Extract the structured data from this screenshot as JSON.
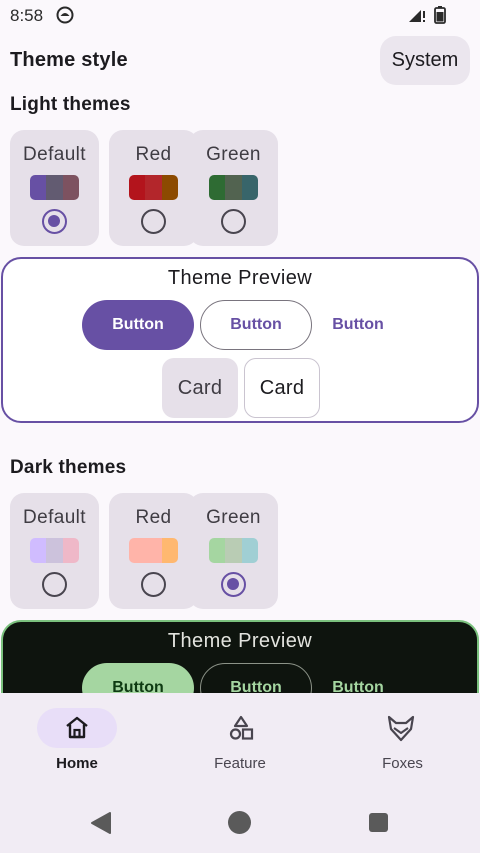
{
  "status_bar": {
    "time": "8:58"
  },
  "header": {
    "title": "Theme style",
    "system_button": "System"
  },
  "light_section": {
    "title": "Light themes",
    "options": [
      {
        "name": "Default",
        "selected": true,
        "swatch": [
          "#6750A4",
          "#625B71",
          "#7D5260"
        ]
      },
      {
        "name": "Red",
        "selected": false,
        "swatch": [
          "#B3141C",
          "#B3262B",
          "#8C4A00"
        ]
      },
      {
        "name": "Green",
        "selected": false,
        "swatch": [
          "#2E6B33",
          "#526350",
          "#38656A"
        ]
      }
    ],
    "preview": {
      "title": "Theme Preview",
      "filled_button": "Button",
      "outlined_button": "Button",
      "text_button": "Button",
      "filled_card": "Card",
      "outlined_card": "Card"
    }
  },
  "dark_section": {
    "title": "Dark themes",
    "options": [
      {
        "name": "Default",
        "selected": false,
        "swatch": [
          "#D0BCFF",
          "#CCC2DC",
          "#EFB8C8"
        ]
      },
      {
        "name": "Red",
        "selected": false,
        "swatch": [
          "#FFB4A9",
          "#FFB4A9",
          "#FFB870"
        ]
      },
      {
        "name": "Green",
        "selected": true,
        "swatch": [
          "#A5D6A1",
          "#B9CCB4",
          "#A0CFD4"
        ]
      }
    ],
    "preview": {
      "title": "Theme Preview",
      "filled_button": "Button",
      "outlined_button": "Button",
      "text_button": "Button"
    }
  },
  "bottom_nav": {
    "items": [
      {
        "label": "Home",
        "icon": "home-icon",
        "active": true
      },
      {
        "label": "Feature",
        "icon": "shapes-icon",
        "active": false
      },
      {
        "label": "Foxes",
        "icon": "fox-icon",
        "active": false
      }
    ]
  },
  "colors": {
    "primary": "#6750A4",
    "dark_primary": "#A5D6A1",
    "surface": "#FBF8FC"
  }
}
